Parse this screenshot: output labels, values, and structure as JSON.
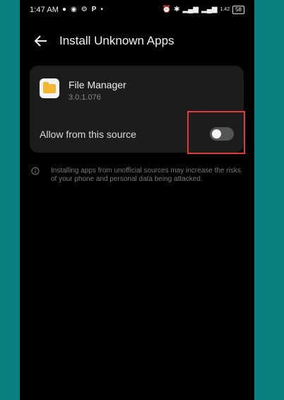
{
  "status_bar": {
    "time": "1:47 AM",
    "left_icons": [
      "whatsapp-icon",
      "camera-icon",
      "gear-icon",
      "p-icon",
      "dot-icon"
    ],
    "right_icons": [
      "alarm-icon",
      "bluetooth-icon",
      "signal-4g-icon",
      "signal-icon",
      "wifi-speed-icon"
    ],
    "speed_text": "1.42",
    "battery": "58"
  },
  "header": {
    "back_icon": "arrow-left-icon",
    "title": "Install Unknown Apps"
  },
  "app": {
    "name": "File Manager",
    "version": "3.0.1.076",
    "icon": "folder-icon"
  },
  "allow": {
    "label": "Allow from this source",
    "enabled": false
  },
  "info": {
    "icon": "info-icon",
    "text": "Installing apps from unofficial sources may increase the risks of your phone and personal data being attacked."
  },
  "colors": {
    "background_outer": "#0a7f80",
    "screen": "#000000",
    "card": "#1c1c1c",
    "highlight": "#e53935",
    "folder": "#f2b630"
  }
}
